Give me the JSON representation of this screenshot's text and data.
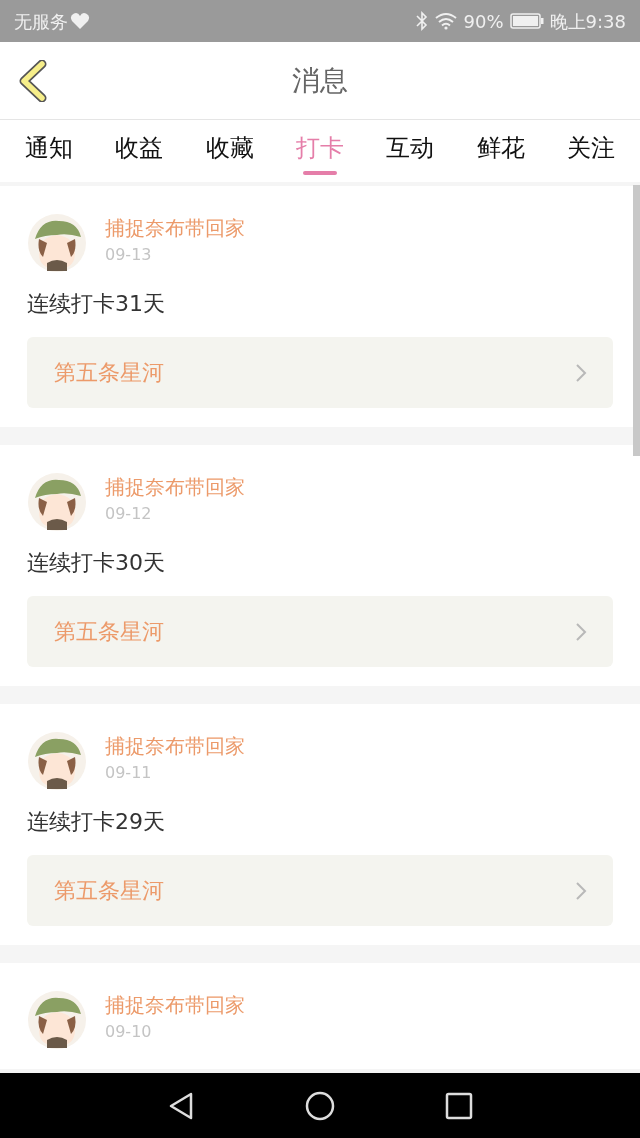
{
  "status_bar": {
    "carrier": "无服务",
    "battery": "90%",
    "time": "晚上9:38"
  },
  "header": {
    "title": "消息"
  },
  "tabs": [
    {
      "label": "通知",
      "selected": false
    },
    {
      "label": "收益",
      "selected": false
    },
    {
      "label": "收藏",
      "selected": false
    },
    {
      "label": "打卡",
      "selected": true
    },
    {
      "label": "互动",
      "selected": false
    },
    {
      "label": "鲜花",
      "selected": false
    },
    {
      "label": "关注",
      "selected": false
    }
  ],
  "messages": [
    {
      "author": "捕捉奈布带回家",
      "date": "09-13",
      "text": "连续打卡31天",
      "link": "第五条星河"
    },
    {
      "author": "捕捉奈布带回家",
      "date": "09-12",
      "text": "连续打卡30天",
      "link": "第五条星河"
    },
    {
      "author": "捕捉奈布带回家",
      "date": "09-11",
      "text": "连续打卡29天",
      "link": "第五条星河"
    },
    {
      "author": "捕捉奈布带回家",
      "date": "09-10"
    }
  ]
}
